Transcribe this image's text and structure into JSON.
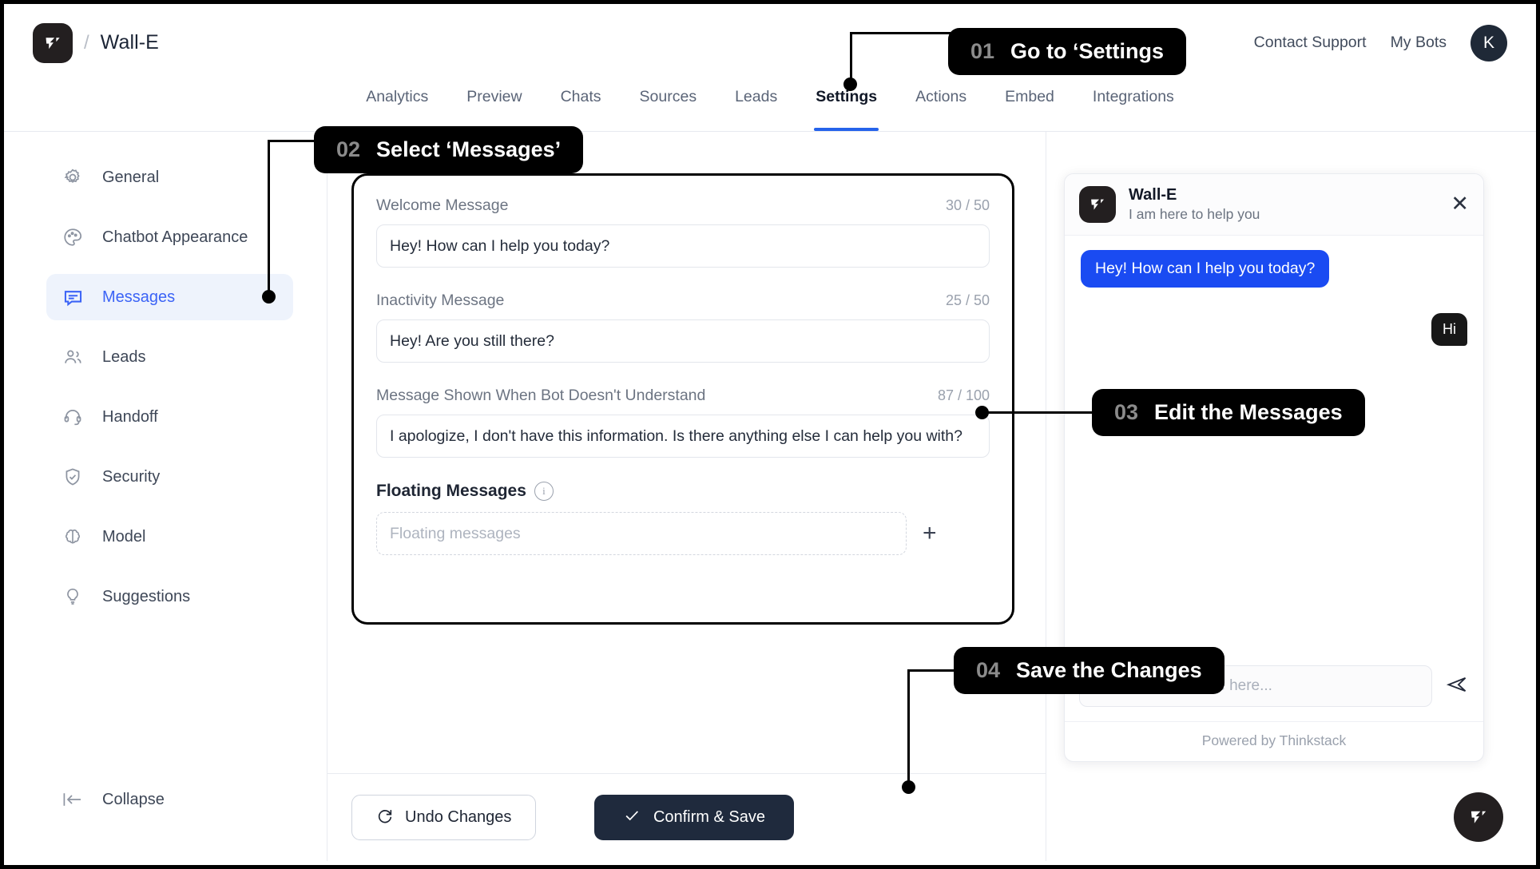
{
  "header": {
    "breadcrumb_separator": "/",
    "bot_name": "Wall-E",
    "contact_support": "Contact Support",
    "my_bots": "My Bots",
    "avatar_initial": "K"
  },
  "tabs": [
    {
      "label": "Analytics",
      "active": false
    },
    {
      "label": "Preview",
      "active": false
    },
    {
      "label": "Chats",
      "active": false
    },
    {
      "label": "Sources",
      "active": false
    },
    {
      "label": "Leads",
      "active": false
    },
    {
      "label": "Settings",
      "active": true
    },
    {
      "label": "Actions",
      "active": false
    },
    {
      "label": "Embed",
      "active": false
    },
    {
      "label": "Integrations",
      "active": false
    }
  ],
  "sidebar": {
    "items": [
      {
        "label": "General",
        "icon": "gear-icon",
        "active": false
      },
      {
        "label": "Chatbot Appearance",
        "icon": "palette-icon",
        "active": false
      },
      {
        "label": "Messages",
        "icon": "message-icon",
        "active": true
      },
      {
        "label": "Leads",
        "icon": "people-icon",
        "active": false
      },
      {
        "label": "Handoff",
        "icon": "headset-icon",
        "active": false
      },
      {
        "label": "Security",
        "icon": "shield-check-icon",
        "active": false
      },
      {
        "label": "Model",
        "icon": "brain-icon",
        "active": false
      },
      {
        "label": "Suggestions",
        "icon": "lightbulb-icon",
        "active": false
      }
    ],
    "collapse_label": "Collapse"
  },
  "form": {
    "welcome": {
      "label": "Welcome Message",
      "counter": "30 / 50",
      "value": "Hey! How can I help you today?"
    },
    "inactivity": {
      "label": "Inactivity Message",
      "counter": "25 / 50",
      "value": "Hey! Are you still there?"
    },
    "fallback": {
      "label": "Message Shown When Bot Doesn't Understand",
      "counter": "87 / 100",
      "value": "I apologize, I don't have this information. Is there anything else I can help you with?"
    },
    "floating": {
      "label": "Floating Messages",
      "info_icon": "info-icon",
      "placeholder": "Floating messages",
      "add_icon": "plus-icon"
    },
    "undo_label": "Undo Changes",
    "undo_icon": "redo-icon",
    "save_label": "Confirm & Save",
    "save_icon": "check-icon"
  },
  "preview": {
    "title": "Wall-E",
    "subtitle": "I am here to help you",
    "close_icon": "close-icon",
    "bot_message": "Hey! How can I help you today?",
    "user_message": "Hi",
    "input_placeholder": "Type your message here...",
    "send_icon": "send-icon",
    "footer": "Powered by Thinkstack",
    "launcher_icon": "thinkstack-logo-icon"
  },
  "callouts": [
    {
      "num": "01",
      "text": "Go to ‘Settings"
    },
    {
      "num": "02",
      "text": "Select ‘Messages’"
    },
    {
      "num": "03",
      "text": "Edit the Messages"
    },
    {
      "num": "04",
      "text": "Save the Changes"
    }
  ],
  "colors": {
    "accent_blue": "#2563eb",
    "bubble_blue": "#1a4bf2",
    "dark": "#1f2a3d",
    "callout_bg": "#000000"
  }
}
